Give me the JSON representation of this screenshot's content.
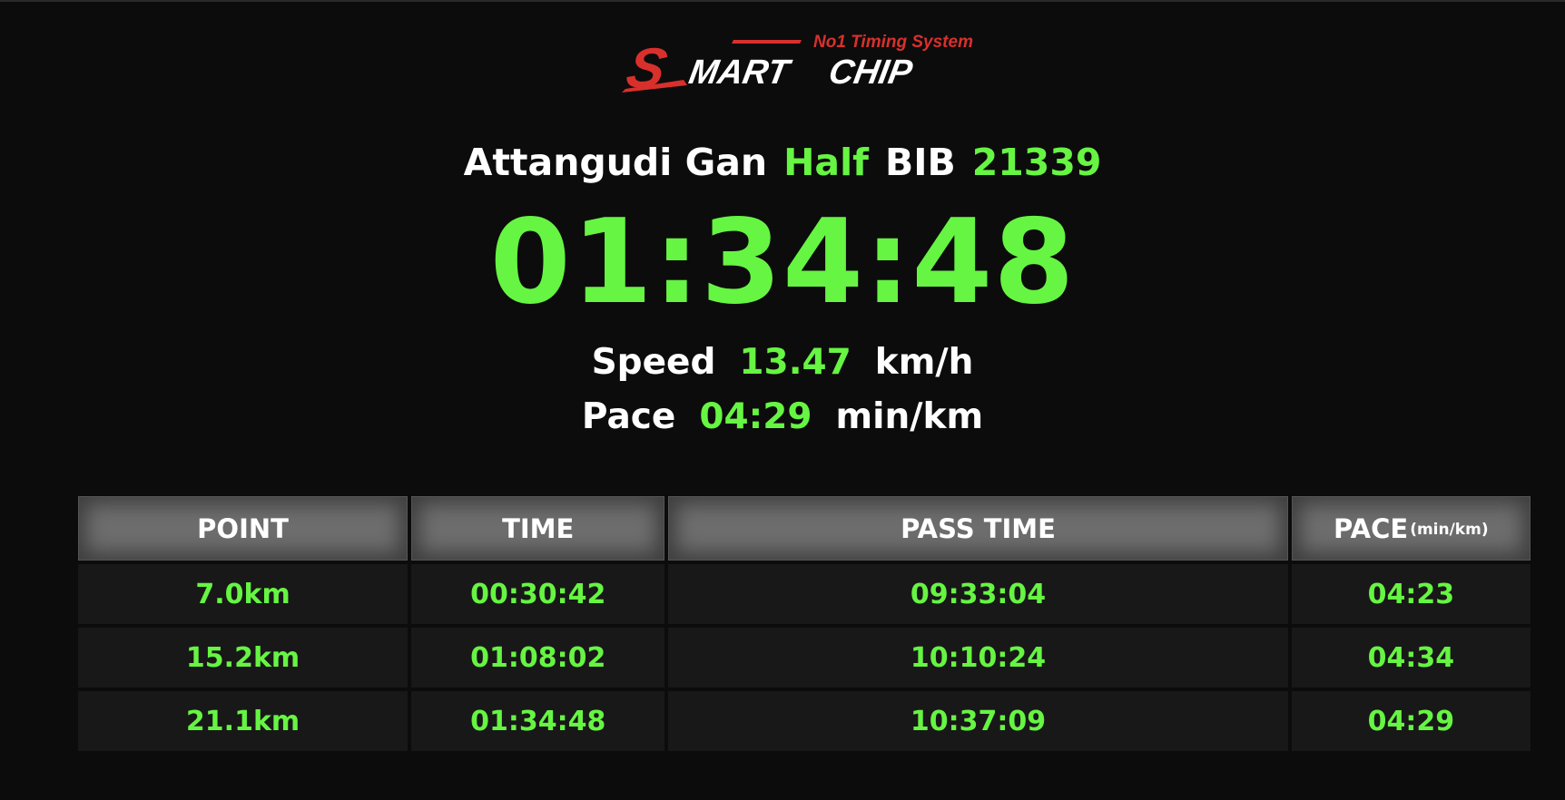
{
  "logo": {
    "tagline": "No1 Timing System",
    "brand": "SMART CHIP",
    "brand_first_letter": "S",
    "brand_rest_a": "MART",
    "brand_rest_b": "CHIP",
    "accent_color": "#d9302c"
  },
  "runner": {
    "name": "Attangudi Gan",
    "category": "Half",
    "bib_label": "BIB",
    "bib_number": "21339"
  },
  "finish_time": "01:34:48",
  "speed": {
    "label": "Speed",
    "value": "13.47",
    "unit": "km/h"
  },
  "pace": {
    "label": "Pace",
    "value": "04:29",
    "unit": "min/km"
  },
  "splits": {
    "headers": {
      "point": "POINT",
      "time": "TIME",
      "pass_time": "PASS TIME",
      "pace": "PACE",
      "pace_unit": "(min/km)"
    },
    "rows": [
      {
        "point": "7.0km",
        "time": "00:30:42",
        "pass_time": "09:33:04",
        "pace": "04:23"
      },
      {
        "point": "15.2km",
        "time": "01:08:02",
        "pass_time": "10:10:24",
        "pace": "04:34"
      },
      {
        "point": "21.1km",
        "time": "01:34:48",
        "pass_time": "10:37:09",
        "pace": "04:29"
      }
    ]
  },
  "colors": {
    "background": "#0c0c0c",
    "highlight_green": "#66f542",
    "header_gray": "#6e6e6e",
    "row_bg": "#181818"
  }
}
